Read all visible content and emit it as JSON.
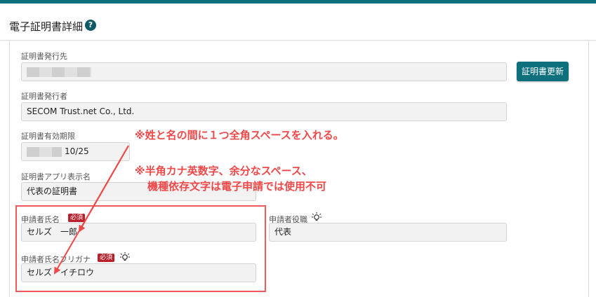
{
  "header": {
    "title": "電子証明書詳細",
    "help_glyph": "?"
  },
  "fields": {
    "issued_to": {
      "label": "証明書発行先"
    },
    "issuer": {
      "label": "証明書発行者",
      "value": "SECOM Trust.net Co., Ltd."
    },
    "expiry": {
      "label": "証明書有効期限",
      "value": "10/25"
    },
    "app_display_name": {
      "label": "証明書アプリ表示名",
      "value": "代表の証明書"
    },
    "applicant_name": {
      "label": "申請者氏名",
      "required": "必須",
      "value": "セルズ　一郎"
    },
    "applicant_title": {
      "label": "申請者役職",
      "value": "代表"
    },
    "applicant_kana": {
      "label": "申請者氏名フリガナ",
      "required": "必須",
      "value": "セルズ　イチロウ"
    }
  },
  "buttons": {
    "renew_certificate": "証明書更新"
  },
  "annotations": {
    "note1": "※姓と名の間に１つ全角スペースを入れる。",
    "note2_line1": "※半角カナ英数字、余分なスペース、",
    "note2_line2": "機種依存文字は電子申請では使用不可"
  },
  "colors": {
    "accent": "#0e6f7d",
    "annotation": "#f04848",
    "required_badge": "#b8202c"
  },
  "icons": [
    "help-icon",
    "lightbulb-icon",
    "arrow-icon"
  ]
}
